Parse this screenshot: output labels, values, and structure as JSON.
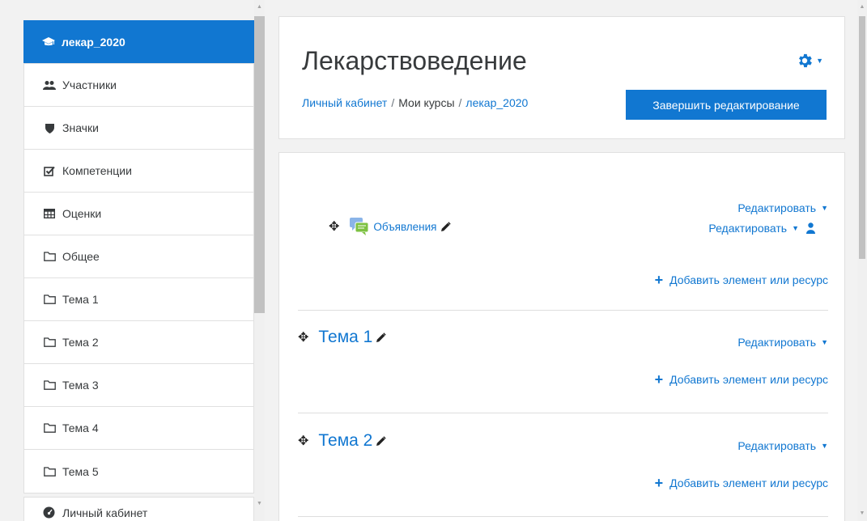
{
  "sidebar": {
    "items": [
      {
        "label": "лекар_2020",
        "icon": "graduation-cap-icon"
      },
      {
        "label": "Участники",
        "icon": "users-icon"
      },
      {
        "label": "Значки",
        "icon": "shield-icon"
      },
      {
        "label": "Компетенции",
        "icon": "checkbox-icon"
      },
      {
        "label": "Оценки",
        "icon": "table-icon"
      },
      {
        "label": "Общее",
        "icon": "folder-icon"
      },
      {
        "label": "Тема 1",
        "icon": "folder-icon"
      },
      {
        "label": "Тема 2",
        "icon": "folder-icon"
      },
      {
        "label": "Тема 3",
        "icon": "folder-icon"
      },
      {
        "label": "Тема 4",
        "icon": "folder-icon"
      },
      {
        "label": "Тема 5",
        "icon": "folder-icon"
      }
    ],
    "dashboard_label": "Личный кабинет"
  },
  "header": {
    "title": "Лекарствоведение",
    "breadcrumb": [
      "Личный кабинет",
      "Мои курсы",
      "лекар_2020"
    ],
    "breadcrumb_sep": "/",
    "finish_button": "Завершить редактирование"
  },
  "content": {
    "general": {
      "edit_label": "Редактировать",
      "activity_name": "Объявления",
      "activity_edit_label": "Редактировать",
      "add_label": "Добавить элемент или ресурс"
    },
    "topics": [
      {
        "name": "Тема 1",
        "edit_label": "Редактировать",
        "add_label": "Добавить элемент или ресурс"
      },
      {
        "name": "Тема 2",
        "edit_label": "Редактировать",
        "add_label": "Добавить элемент или ресурс"
      }
    ]
  },
  "colors": {
    "accent": "#1177d1",
    "background": "#f2f2f2",
    "text": "#373a3c"
  }
}
